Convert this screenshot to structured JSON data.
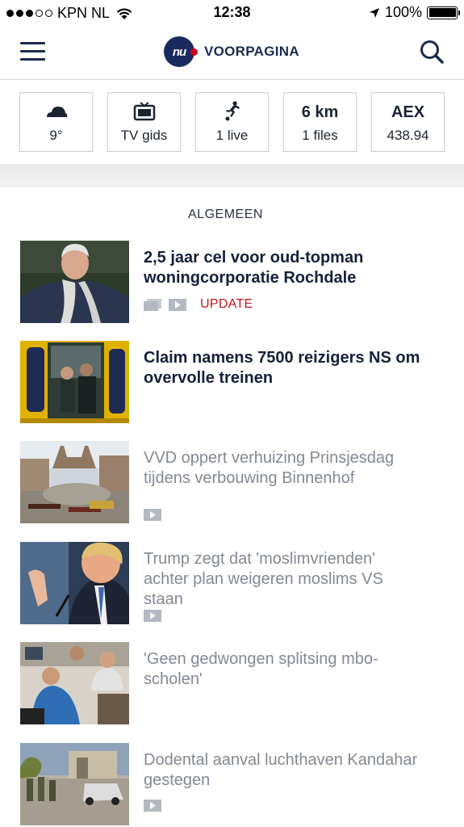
{
  "status": {
    "carrier": "KPN NL",
    "time": "12:38",
    "battery": "100%",
    "battery_level": 1.0
  },
  "nav": {
    "logo_text": "nu",
    "page_label": "VOORPAGINA"
  },
  "widgets": [
    {
      "icon": "cloud-icon",
      "label": "9°"
    },
    {
      "icon": "tv-icon",
      "label": "TV gids"
    },
    {
      "icon": "soccer-player-icon",
      "label": "1 live"
    },
    {
      "big": "6 km",
      "label": "1 files"
    },
    {
      "big": "AEX",
      "label": "438.94"
    }
  ],
  "section": {
    "title": "ALGEMEEN"
  },
  "articles": [
    {
      "title": "2,5 jaar cel voor oud-topman woningcorporatie Rochdale",
      "read": false,
      "media": [
        "gallery-icon",
        "video-icon"
      ],
      "badge": "UPDATE"
    },
    {
      "title": "Claim namens 7500 reizigers NS om overvolle treinen",
      "read": false,
      "media": [],
      "badge": ""
    },
    {
      "title": "VVD oppert verhuizing Prinsjesdag tijdens verbouwing Binnenhof",
      "read": true,
      "media": [
        "video-icon"
      ],
      "badge": ""
    },
    {
      "title": "Trump zegt dat 'moslimvrienden' achter plan weigeren moslims VS staan",
      "read": true,
      "media": [
        "video-icon"
      ],
      "badge": ""
    },
    {
      "title": "'Geen gedwongen splitsing mbo-scholen'",
      "read": true,
      "media": [],
      "badge": ""
    },
    {
      "title": "Dodental aanval luchthaven Kandahar gestegen",
      "read": true,
      "media": [
        "video-icon"
      ],
      "badge": ""
    }
  ],
  "colors": {
    "brand_navy": "#1b2a5e",
    "brand_red": "#d0021b",
    "update_red": "#c4161c",
    "read_grey": "#838896"
  }
}
